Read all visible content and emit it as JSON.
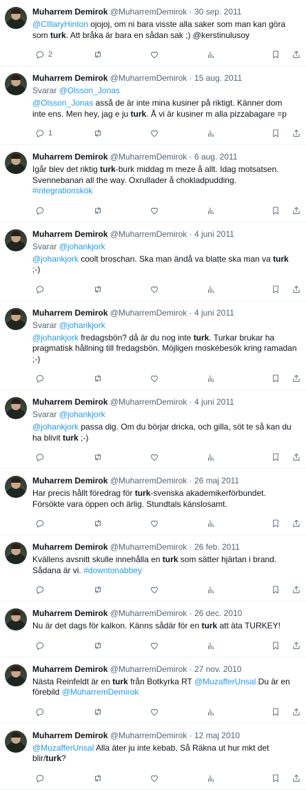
{
  "labels": {
    "replying_to": "Svarar "
  },
  "colors": {
    "link": "#1d9bf0",
    "muted": "#536471",
    "text": "#0f1419",
    "divider": "#eff3f4"
  },
  "icons": [
    "reply-icon",
    "retweet-icon",
    "like-icon",
    "views-icon",
    "bookmark-icon",
    "share-icon"
  ],
  "tweets": [
    {
      "author": "Muharrem Demirok",
      "handle": "@MuharremDemirok",
      "date": "30 sep. 2011",
      "reply_to": null,
      "segments": [
        {
          "type": "mention",
          "text": "@CIllaryHinton"
        },
        {
          "type": "text",
          "text": " ojojoj, om ni bara visste alla saker som man kan göra som "
        },
        {
          "type": "bold",
          "text": "turk"
        },
        {
          "type": "text",
          "text": ". Att bråka är bara en sådan sak ;) @kerstinulusoy"
        }
      ],
      "reply_count": "2"
    },
    {
      "author": "Muharrem Demirok",
      "handle": "@MuharremDemirok",
      "date": "15 aug. 2011",
      "reply_to": "@Olsson_Jonas",
      "segments": [
        {
          "type": "mention",
          "text": "@Olsson_Jonas"
        },
        {
          "type": "text",
          "text": " asså de är inte mina kusiner på riktigt. Känner dom inte ens. Men hey, jag e ju "
        },
        {
          "type": "bold",
          "text": "turk"
        },
        {
          "type": "text",
          "text": ". Å vi är kusiner m alla pizzabagare =p"
        }
      ],
      "reply_count": "1"
    },
    {
      "author": "Muharrem Demirok",
      "handle": "@MuharremDemirok",
      "date": "6 aug. 2011",
      "reply_to": null,
      "segments": [
        {
          "type": "text",
          "text": "Igår blev det riktig "
        },
        {
          "type": "bold",
          "text": "turk"
        },
        {
          "type": "text",
          "text": "-burk middag m meze å allt. Idag motsatsen. Svennebanan all the way. Oxrullader å chokladpudding. "
        },
        {
          "type": "hashtag",
          "text": "#integrationskök"
        }
      ],
      "reply_count": ""
    },
    {
      "author": "Muharrem Demirok",
      "handle": "@MuharremDemirok",
      "date": "4 juni 2011",
      "reply_to": "@johankjork",
      "segments": [
        {
          "type": "mention",
          "text": "@johankjork"
        },
        {
          "type": "text",
          "text": " coolt broschan. Ska man ändå va blatte ska man va "
        },
        {
          "type": "bold",
          "text": "turk"
        },
        {
          "type": "text",
          "text": " ;-)"
        }
      ],
      "reply_count": ""
    },
    {
      "author": "Muharrem Demirok",
      "handle": "@MuharremDemirok",
      "date": "4 juni 2011",
      "reply_to": "@johankjork",
      "segments": [
        {
          "type": "mention",
          "text": "@johankjork"
        },
        {
          "type": "text",
          "text": " fredagsbön? då är du nog inte "
        },
        {
          "type": "bold",
          "text": "turk"
        },
        {
          "type": "text",
          "text": ". Turkar brukar ha pragmatisk hållning till fredagsbön. Möjligen moskébesök kring ramadan ;-)"
        }
      ],
      "reply_count": ""
    },
    {
      "author": "Muharrem Demirok",
      "handle": "@MuharremDemirok",
      "date": "4 juni 2011",
      "reply_to": "@johankjork",
      "segments": [
        {
          "type": "mention",
          "text": "@johankjork"
        },
        {
          "type": "text",
          "text": " passa dig. Om du börjar dricka, och gilla, söt te så kan du ha blivit "
        },
        {
          "type": "bold",
          "text": "turk"
        },
        {
          "type": "text",
          "text": " ;-)"
        }
      ],
      "reply_count": ""
    },
    {
      "author": "Muharrem Demirok",
      "handle": "@MuharremDemirok",
      "date": "26 maj 2011",
      "reply_to": null,
      "segments": [
        {
          "type": "text",
          "text": "Har precis hållt föredrag för "
        },
        {
          "type": "bold",
          "text": "turk"
        },
        {
          "type": "text",
          "text": "-svenska akademikerförbundet. Försökte vara öppen och ärlig. Stundtals känslosamt."
        }
      ],
      "reply_count": ""
    },
    {
      "author": "Muharrem Demirok",
      "handle": "@MuharremDemirok",
      "date": "26 feb. 2011",
      "reply_to": null,
      "segments": [
        {
          "type": "text",
          "text": "Kvällens avsnitt skulle innehålla en "
        },
        {
          "type": "bold",
          "text": "turk"
        },
        {
          "type": "text",
          "text": " som sätter hjärtan i brand. Sådana är vi. "
        },
        {
          "type": "hashtag",
          "text": "#downtonabbey"
        }
      ],
      "reply_count": ""
    },
    {
      "author": "Muharrem Demirok",
      "handle": "@MuharremDemirok",
      "date": "26 dec. 2010",
      "reply_to": null,
      "segments": [
        {
          "type": "text",
          "text": "Nu är det dags för kalkon. Känns sådär för en "
        },
        {
          "type": "bold",
          "text": "turk"
        },
        {
          "type": "text",
          "text": " att äta TURKEY!"
        }
      ],
      "reply_count": ""
    },
    {
      "author": "Muharrem Demirok",
      "handle": "@MuharremDemirok",
      "date": "27 nov. 2010",
      "reply_to": null,
      "segments": [
        {
          "type": "text",
          "text": "Nästa Reinfeldt är en "
        },
        {
          "type": "bold",
          "text": "turk"
        },
        {
          "type": "text",
          "text": " från Botkyrka RT "
        },
        {
          "type": "mention",
          "text": "@MuzafferUnsal"
        },
        {
          "type": "text",
          "text": " Du är en förebild "
        },
        {
          "type": "mention",
          "text": "@MuharremDemirok"
        }
      ],
      "reply_count": ""
    },
    {
      "author": "Muharrem Demirok",
      "handle": "@MuharremDemirok",
      "date": "12 maj 2010",
      "reply_to": null,
      "segments": [
        {
          "type": "mention",
          "text": "@MuzafferUnsal"
        },
        {
          "type": "text",
          "text": " Alla äter ju inte kebab. Så Räkna ut hur mkt det blir/"
        },
        {
          "type": "bold",
          "text": "turk"
        },
        {
          "type": "text",
          "text": "?"
        }
      ],
      "reply_count": ""
    }
  ]
}
